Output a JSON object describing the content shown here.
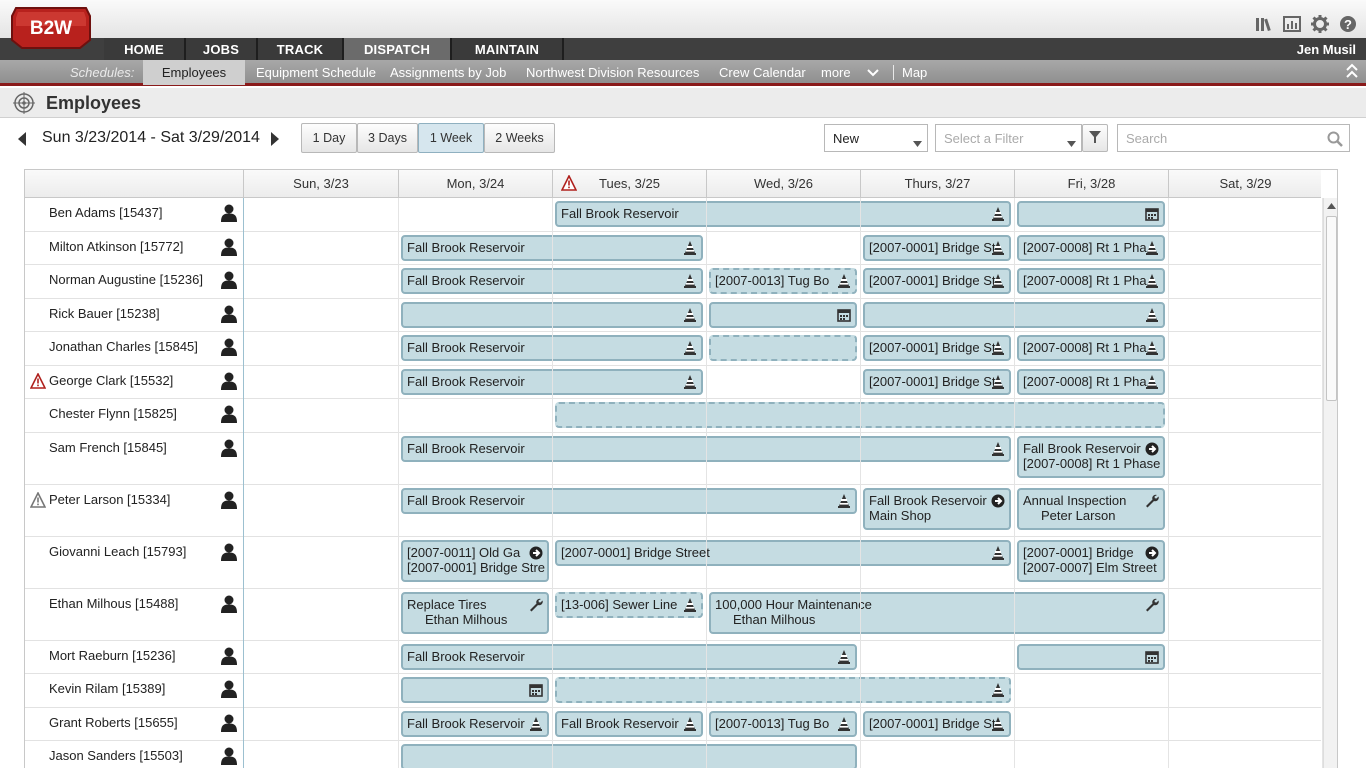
{
  "app": {
    "logo": "B2W",
    "user": "Jen Musil",
    "top_icons": [
      "library-icon",
      "report-icon",
      "gear-icon",
      "help-icon"
    ]
  },
  "nav": {
    "tabs": [
      "HOME",
      "JOBS",
      "TRACK",
      "DISPATCH",
      "MAINTAIN"
    ],
    "active": "DISPATCH"
  },
  "subnav": {
    "label": "Schedules:",
    "items": [
      "Employees",
      "Equipment Schedule",
      "Assignments by Job",
      "Northwest Division Resources",
      "Crew Calendar",
      "more",
      "Map"
    ],
    "active": "Employees"
  },
  "page": {
    "title": "Employees",
    "date_range": "Sun 3/23/2014 - Sat 3/29/2014"
  },
  "views": [
    "1 Day",
    "3 Days",
    "1 Week",
    "2 Weeks"
  ],
  "active_view": "1 Week",
  "filters": {
    "status_value": "New",
    "filter_placeholder": "Select a Filter",
    "search_placeholder": "Search"
  },
  "days": [
    "Sun, 3/23",
    "Mon, 3/24",
    "Tues, 3/25",
    "Wed, 3/26",
    "Thurs, 3/27",
    "Fri, 3/28",
    "Sat, 3/29"
  ],
  "warning_day": "Tues, 3/25",
  "employees": [
    {
      "name": "Ben Adams [15437]",
      "warn": "",
      "events": [
        {
          "d": 2,
          "span": 3,
          "text": "Fall Brook Reservoir",
          "icon": "cone"
        },
        {
          "d": 5,
          "span": 1,
          "text": "",
          "icon": "calendar"
        }
      ]
    },
    {
      "name": "Milton Atkinson [15772]",
      "warn": "",
      "events": [
        {
          "d": 1,
          "span": 2,
          "text": "Fall Brook Reservoir",
          "icon": "cone"
        },
        {
          "d": 4,
          "span": 1,
          "text": "[2007-0001] Bridge St",
          "icon": "cone"
        },
        {
          "d": 5,
          "span": 1,
          "text": "[2007-0008] Rt 1 Pha",
          "icon": "cone"
        }
      ]
    },
    {
      "name": "Norman Augustine [15236]",
      "warn": "",
      "events": [
        {
          "d": 1,
          "span": 2,
          "text": "Fall Brook Reservoir",
          "icon": "cone"
        },
        {
          "d": 3,
          "span": 1,
          "text": "[2007-0013] Tug Bo",
          "icon": "cone",
          "dash": true
        },
        {
          "d": 4,
          "span": 1,
          "text": "[2007-0001] Bridge St",
          "icon": "cone"
        },
        {
          "d": 5,
          "span": 1,
          "text": "[2007-0008] Rt 1 Pha",
          "icon": "cone"
        }
      ]
    },
    {
      "name": "Rick Bauer [15238]",
      "warn": "",
      "events": [
        {
          "d": 1,
          "span": 2,
          "text": "",
          "icon": "cone"
        },
        {
          "d": 3,
          "span": 1,
          "text": "",
          "icon": "calendar"
        },
        {
          "d": 4,
          "span": 2,
          "text": "",
          "icon": "cone"
        }
      ]
    },
    {
      "name": "Jonathan Charles [15845]",
      "warn": "",
      "events": [
        {
          "d": 1,
          "span": 2,
          "text": "Fall Brook Reservoir",
          "icon": "cone"
        },
        {
          "d": 3,
          "span": 1,
          "text": "",
          "icon": "",
          "dash": true
        },
        {
          "d": 4,
          "span": 1,
          "text": "[2007-0001] Bridge St",
          "icon": "cone"
        },
        {
          "d": 5,
          "span": 1,
          "text": "[2007-0008] Rt 1 Pha",
          "icon": "cone"
        }
      ]
    },
    {
      "name": "George Clark [15532]",
      "warn": "red",
      "events": [
        {
          "d": 1,
          "span": 2,
          "text": "Fall Brook Reservoir",
          "icon": "cone"
        },
        {
          "d": 4,
          "span": 1,
          "text": "[2007-0001] Bridge St",
          "icon": "cone"
        },
        {
          "d": 5,
          "span": 1,
          "text": "[2007-0008] Rt 1 Pha",
          "icon": "cone"
        }
      ]
    },
    {
      "name": "Chester Flynn [15825]",
      "warn": "",
      "events": [
        {
          "d": 2,
          "span": 4,
          "text": "",
          "icon": "",
          "dash": true
        }
      ]
    },
    {
      "name": "Sam French [15845]",
      "warn": "",
      "tall": true,
      "events": [
        {
          "d": 1,
          "span": 4,
          "text": "Fall Brook Reservoir",
          "icon": "cone"
        },
        {
          "d": 5,
          "span": 1,
          "text": "Fall Brook Reservoir",
          "text2": "[2007-0008] Rt 1 Phase",
          "icon": "arrow"
        }
      ]
    },
    {
      "name": "Peter Larson [15334]",
      "warn": "gray",
      "tall": true,
      "events": [
        {
          "d": 1,
          "span": 3,
          "text": "Fall Brook Reservoir",
          "icon": "cone"
        },
        {
          "d": 4,
          "span": 1,
          "text": "Fall Brook Reservoir",
          "text2": "Main Shop",
          "icon": "arrow"
        },
        {
          "d": 5,
          "span": 1,
          "text": "Annual Inspection",
          "text2": "Peter Larson",
          "icon": "wrench",
          "indent": true
        }
      ]
    },
    {
      "name": "Giovanni Leach [15793]",
      "warn": "",
      "tall": true,
      "events": [
        {
          "d": 1,
          "span": 1,
          "text": "[2007-0011] Old Ga",
          "text2": "[2007-0001] Bridge Stre",
          "icon": "arrow"
        },
        {
          "d": 2,
          "span": 3,
          "text": "[2007-0001] Bridge Street",
          "icon": "cone"
        },
        {
          "d": 5,
          "span": 1,
          "text": "[2007-0001] Bridge",
          "text2": "[2007-0007] Elm Street",
          "icon": "arrow"
        }
      ]
    },
    {
      "name": "Ethan Milhous [15488]",
      "warn": "",
      "tall": true,
      "events": [
        {
          "d": 1,
          "span": 1,
          "text": "Replace Tires",
          "text2": "Ethan Milhous",
          "icon": "wrench",
          "indent": true
        },
        {
          "d": 2,
          "span": 1,
          "text": "[13-006] Sewer Line",
          "icon": "cone",
          "dash": true
        },
        {
          "d": 3,
          "span": 3,
          "text": "100,000 Hour Maintenance",
          "text2": "Ethan Milhous",
          "icon": "wrench",
          "indent": true
        }
      ]
    },
    {
      "name": "Mort Raeburn [15236]",
      "warn": "",
      "events": [
        {
          "d": 1,
          "span": 3,
          "text": "Fall Brook Reservoir",
          "icon": "cone"
        },
        {
          "d": 5,
          "span": 1,
          "text": "",
          "icon": "calendar"
        }
      ]
    },
    {
      "name": "Kevin Rilam [15389]",
      "warn": "",
      "events": [
        {
          "d": 1,
          "span": 1,
          "text": "",
          "icon": "calendar"
        },
        {
          "d": 2,
          "span": 3,
          "text": "",
          "icon": "cone",
          "dash": true
        }
      ]
    },
    {
      "name": "Grant Roberts [15655]",
      "warn": "",
      "events": [
        {
          "d": 1,
          "span": 1,
          "text": "Fall Brook Reservoir",
          "icon": "cone"
        },
        {
          "d": 2,
          "span": 1,
          "text": "Fall Brook Reservoir",
          "icon": "cone"
        },
        {
          "d": 3,
          "span": 1,
          "text": "[2007-0013] Tug Bo",
          "icon": "cone"
        },
        {
          "d": 4,
          "span": 1,
          "text": "[2007-0001] Bridge St",
          "icon": "cone"
        }
      ]
    },
    {
      "name": "Jason Sanders [15503]",
      "warn": "",
      "events": [
        {
          "d": 1,
          "span": 3,
          "text": "",
          "icon": ""
        }
      ]
    }
  ]
}
